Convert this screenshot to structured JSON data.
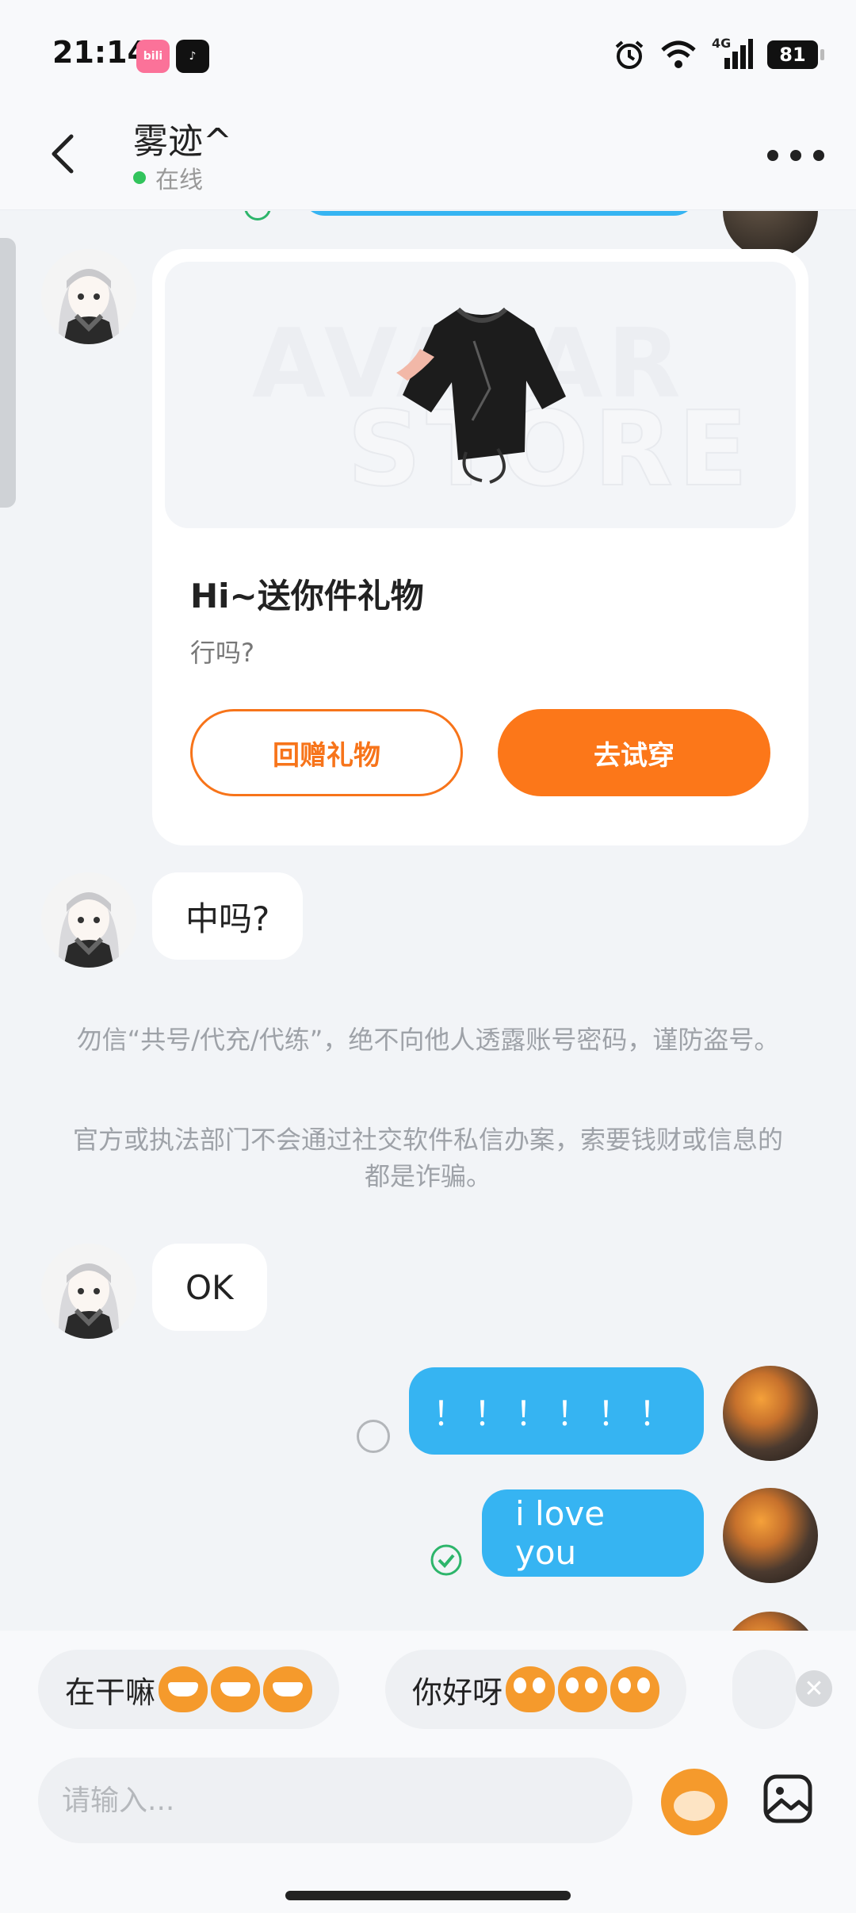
{
  "status_bar": {
    "time": "21:14",
    "apps": [
      "bilibili-icon",
      "tiktok-icon"
    ],
    "network": "4G",
    "battery": "81"
  },
  "header": {
    "contact_name": "雾迹^",
    "presence": "在线"
  },
  "gift_card": {
    "watermark_line1": "AVATAR",
    "watermark_line2": "STORE",
    "title": "Hi~送你件礼物",
    "subtitle": "行吗?",
    "return_gift_label": "回赠礼物",
    "try_on_label": "去试穿"
  },
  "messages": [
    {
      "from": "peer",
      "text": "中吗?"
    },
    {
      "from": "peer",
      "text": "OK"
    },
    {
      "from": "self",
      "text": "！！！！！！",
      "status": "pending"
    },
    {
      "from": "self",
      "text": "i love you",
      "status": "read"
    }
  ],
  "notices": [
    "勿信“共号/代充/代练”，绝不向他人透露账号密码，谨防盗号。",
    "官方或执法部门不会通过社交软件私信办案，索要钱财或信息的都是诈骗。"
  ],
  "quick_replies": [
    {
      "text": "在干嘛",
      "emoji_count": 3
    },
    {
      "text": "你好呀",
      "emoji_count": 3
    }
  ],
  "input": {
    "placeholder": "请输入..."
  },
  "colors": {
    "accent_orange": "#fc7719",
    "self_bubble": "#36b4f2",
    "online_green": "#32c45c"
  }
}
